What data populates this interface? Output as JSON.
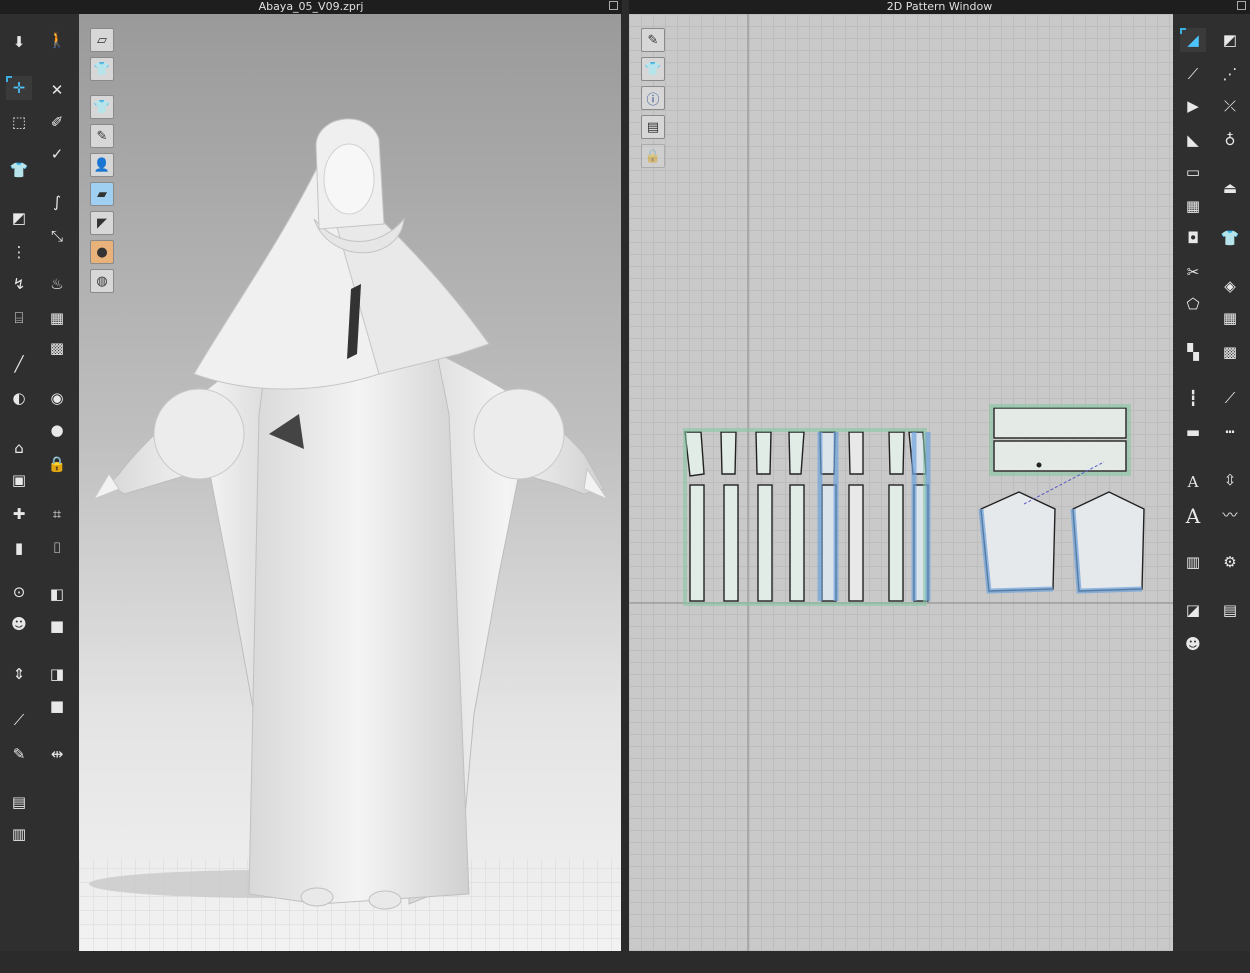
{
  "viewport_window": {
    "title": "Abaya_05_V09.zprj"
  },
  "pattern_window": {
    "title": "2D Pattern Window"
  },
  "icons": {
    "left_toolbar_col1": [
      "move-down-icon",
      "transform-icon",
      "lasso-select-icon",
      "garment-icon",
      "fold-icon",
      "pin-icon",
      "stitch-icon",
      "sewing-machine-icon",
      "needle-icon",
      "tape-icon",
      "avatar-hanger-icon",
      "shirt-icon",
      "tshirt-front-icon",
      "tshirt-back-icon",
      "button-icon",
      "avatar-icon",
      "measure-icon",
      "ruler-icon",
      "pen-icon",
      "shirt-arrange-icon",
      "shirt-stack-icon"
    ],
    "left_toolbar_col2": [
      "walk-icon",
      "pin-tool-icon",
      "brush-icon",
      "check-icon",
      "smooth-icon",
      "fold-arrange-icon",
      "fabric-icon",
      "grid-shirt-icon",
      "circle-button-icon",
      "button-hole-icon",
      "lock-button-icon",
      "zipper-icon",
      "zipper-pull-icon",
      "flat-fabric-icon",
      "flat-fabric-2-icon",
      "flat-fabric-3-icon",
      "flip-icon"
    ],
    "viewport_buttons": [
      "fabric-display-icon",
      "shirt-display-icon",
      "eye-garment-icon",
      "eye-brush-icon",
      "eye-avatar-icon",
      "blue-texture-icon",
      "dark-shape-icon",
      "skin-avatar-icon",
      "globe-eye-icon"
    ],
    "pattern_buttons": [
      "eye-pen-icon",
      "eye-shirt-icon",
      "info-icon",
      "layer-icon",
      "lock-shirt-icon"
    ],
    "right_toolbar_col1": [
      "edit-pattern-icon",
      "edit-point-icon",
      "segment-icon",
      "polygon-icon",
      "rectangle-icon",
      "internal-polygon-icon",
      "dart-icon",
      "cut-icon",
      "fold-pattern-icon",
      "notch-icon",
      "tape-measure-icon",
      "ruler-length-icon",
      "text-small-icon",
      "text-large-icon",
      "grading-icon",
      "puzzle-icon",
      "avatar-small-icon"
    ],
    "right_toolbar_col2": [
      "transform-pattern-icon",
      "seam-icon",
      "seam-2-icon",
      "iron-icon",
      "shirt-outline-icon",
      "sew-shirt-icon",
      "shirt-checker-icon",
      "shirt-checker-2-icon",
      "line-icon",
      "dashed-line-icon",
      "zip-icon",
      "zigzag-icon",
      "gear-shirt-icon",
      "stack-icon"
    ]
  }
}
